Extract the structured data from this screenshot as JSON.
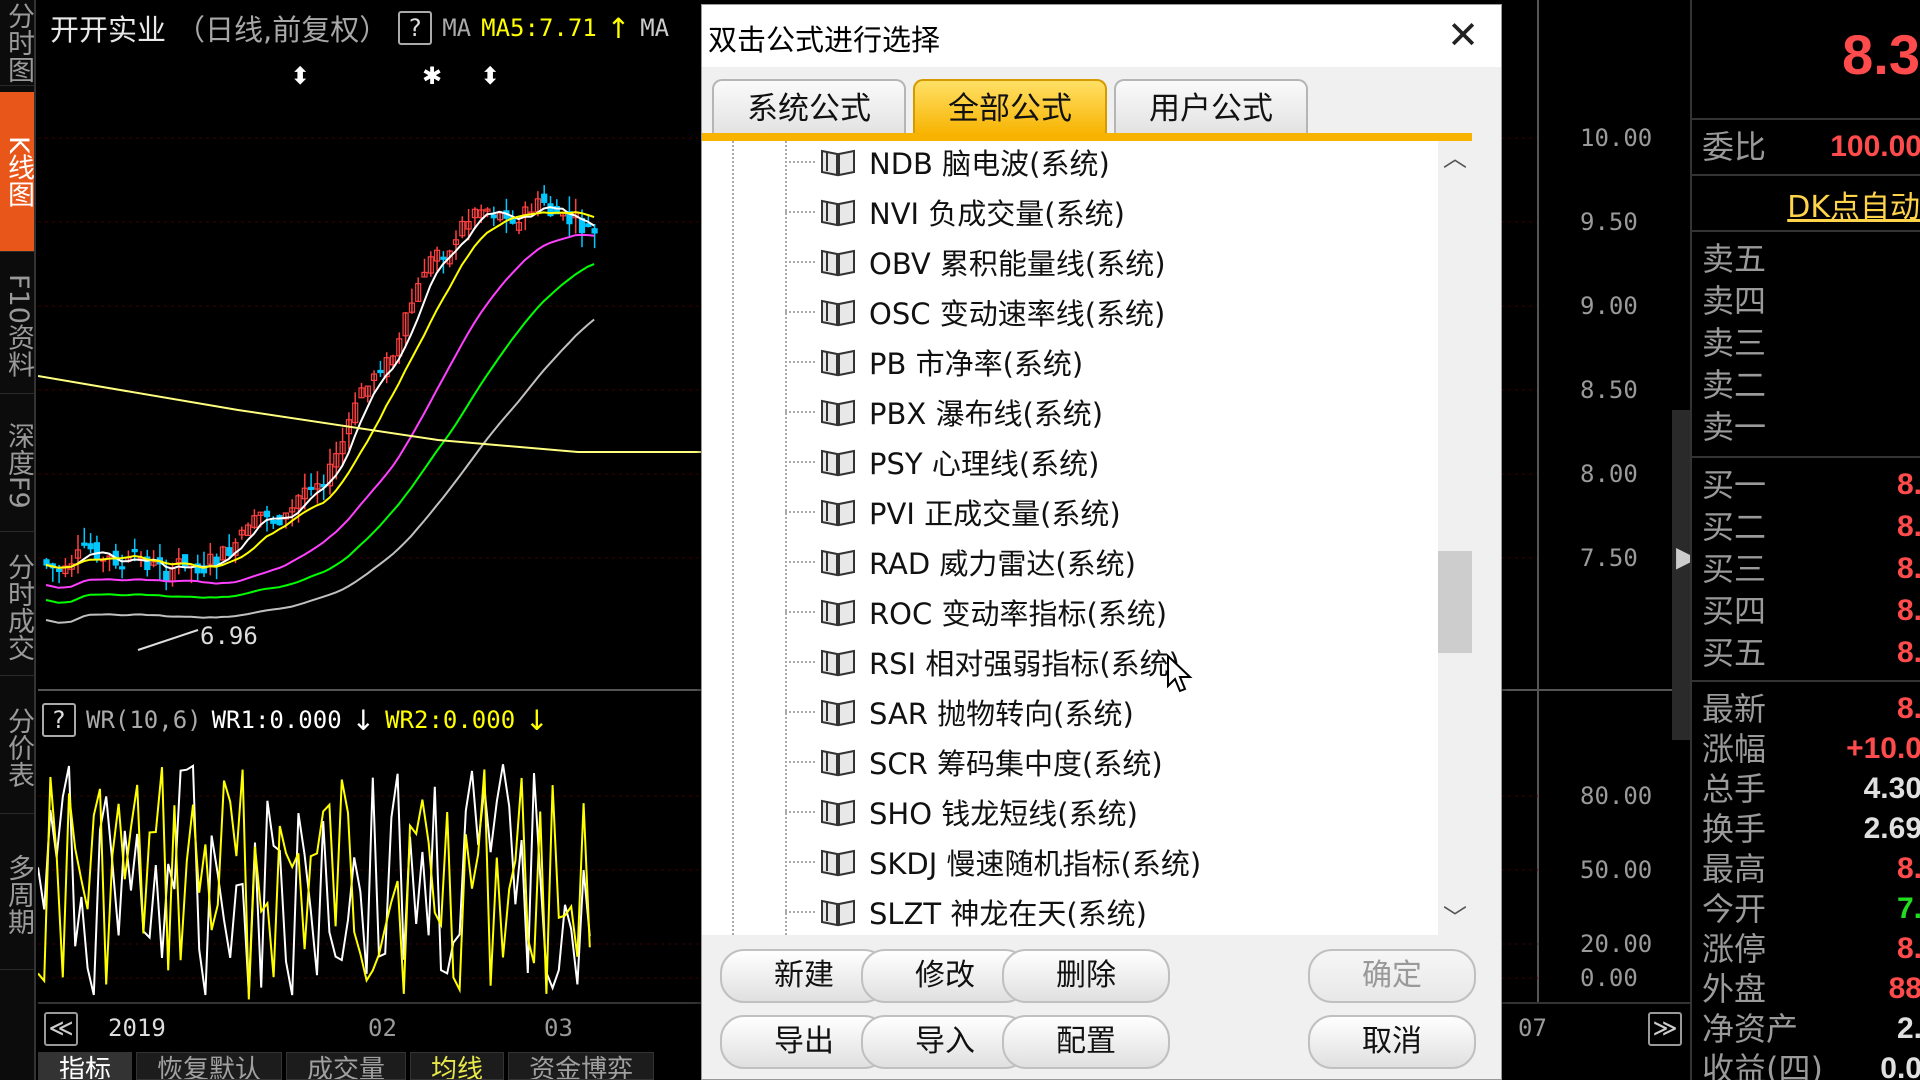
{
  "left_tabs": [
    {
      "label": "分时图",
      "active": false
    },
    {
      "label": "K线图",
      "active": true
    },
    {
      "label": "F10资料",
      "active": false
    },
    {
      "label": "深度F9",
      "active": false
    },
    {
      "label": "分时成交",
      "active": false
    },
    {
      "label": "分价表",
      "active": false
    },
    {
      "label": "多周期",
      "active": false
    }
  ],
  "chart": {
    "title_name": "开开实业",
    "title_period": "（日线,前复权）",
    "help": "?",
    "ma_label": "MA",
    "ma5": "MA5:7.71",
    "ma_cut": "MA",
    "low_marker": "6.96",
    "wr_title": "WR(10,6)",
    "wr1": "WR1:0.000",
    "wr2": "WR2:0.000",
    "price_ticks": [
      "10.00",
      "9.50",
      "9.00",
      "8.50",
      "8.00",
      "7.50"
    ],
    "wr_ticks": [
      "80.00",
      "50.00",
      "20.00",
      "0.00"
    ],
    "x_labels": [
      "2019",
      "02",
      "03",
      "07"
    ],
    "nav_left": "≪",
    "nav_right": "≫",
    "colors": {
      "up": "#ff4040",
      "down": "#00c8ff",
      "ma5": "#ffffff",
      "ma10": "#ffff00",
      "ma20": "#ff40ff",
      "ma60": "#00ff00",
      "ma120": "#c0c0c0",
      "ma250": "#ffff80",
      "wr1": "#ffff00",
      "wr2": "#ffffff"
    }
  },
  "bottom_tabs": [
    {
      "label": "指标",
      "active": true,
      "yellow": false
    },
    {
      "label": "恢复默认",
      "active": false,
      "yellow": false
    },
    {
      "label": "成交量",
      "active": false,
      "yellow": false
    },
    {
      "label": "均线",
      "active": false,
      "yellow": true
    },
    {
      "label": "资金博弈",
      "active": false,
      "yellow": false
    }
  ],
  "quote": {
    "price": "8.3",
    "weibi_label": "委比",
    "weibi_value": "100.00",
    "dk_link": "DK点自动",
    "sell": [
      {
        "label": "卖五",
        "value": ""
      },
      {
        "label": "卖四",
        "value": ""
      },
      {
        "label": "卖三",
        "value": ""
      },
      {
        "label": "卖二",
        "value": ""
      },
      {
        "label": "卖一",
        "value": ""
      }
    ],
    "buy": [
      {
        "label": "买一",
        "value": "8."
      },
      {
        "label": "买二",
        "value": "8."
      },
      {
        "label": "买三",
        "value": "8."
      },
      {
        "label": "买四",
        "value": "8."
      },
      {
        "label": "买五",
        "value": "8."
      }
    ],
    "stats": [
      {
        "label": "最新",
        "value": "8.",
        "color": "#ff4b4b"
      },
      {
        "label": "涨幅",
        "value": "+10.0",
        "color": "#ff4b4b"
      },
      {
        "label": "总手",
        "value": "4.30",
        "color": "#e0e0e0"
      },
      {
        "label": "换手",
        "value": "2.69",
        "color": "#e0e0e0"
      },
      {
        "label": "最高",
        "value": "8.",
        "color": "#ff4b4b"
      },
      {
        "label": "今开",
        "value": "7.",
        "color": "#22dd22"
      },
      {
        "label": "涨停",
        "value": "8.",
        "color": "#ff4b4b"
      },
      {
        "label": "外盘",
        "value": "88",
        "color": "#ff4b4b"
      },
      {
        "label": "净资产",
        "value": "2.",
        "color": "#e0e0e0"
      },
      {
        "label": "收益(四)",
        "value": "0.0",
        "color": "#e0e0e0"
      }
    ]
  },
  "dialog": {
    "title": "双击公式进行选择",
    "close": "✕",
    "tabs": [
      {
        "label": "系统公式",
        "active": false
      },
      {
        "label": "全部公式",
        "active": true
      },
      {
        "label": "用户公式",
        "active": false
      }
    ],
    "items": [
      "NDB 脑电波(系统)",
      "NVI 负成交量(系统)",
      "OBV 累积能量线(系统)",
      "OSC 变动速率线(系统)",
      "PB 市净率(系统)",
      "PBX 瀑布线(系统)",
      "PSY 心理线(系统)",
      "PVI 正成交量(系统)",
      "RAD 威力雷达(系统)",
      "ROC 变动率指标(系统)",
      "RSI 相对强弱指标(系统)",
      "SAR 抛物转向(系统)",
      "SCR 筹码集中度(系统)",
      "SHO 钱龙短线(系统)",
      "SKDJ 慢速随机指标(系统)",
      "SLZT 神龙在天(系统)"
    ],
    "scroll_up": "︿",
    "scroll_down": "﹀",
    "buttons": {
      "new": "新建",
      "modify": "修改",
      "delete": "删除",
      "ok": "确定",
      "export": "导出",
      "import": "导入",
      "config": "配置",
      "cancel": "取消"
    }
  }
}
